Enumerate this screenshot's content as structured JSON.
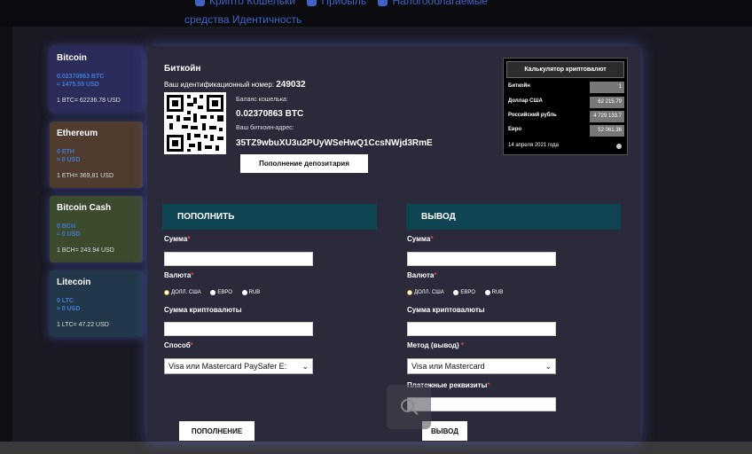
{
  "topnav": {
    "row1": [
      "Крипто Кошельки",
      "Прибыль",
      "Налогооблагаемые"
    ],
    "row2": [
      "средства",
      "Идентичность"
    ]
  },
  "wallets": [
    {
      "name": "Bitcoin",
      "amount": "0.02370863 BTC",
      "usd": "≈ 1475.55 USD",
      "rate": "1 BTC= 62236.78 USD",
      "color": "#2b2c5a"
    },
    {
      "name": "Ethereum",
      "amount": "0 ETH",
      "usd": "≈ 0 USD",
      "rate": "1 ETH= 369,81 USD",
      "color": "#4f3c2e"
    },
    {
      "name": "Bitcoin Cash",
      "amount": "0 BCH",
      "usd": "≈ 0 USD",
      "rate": "1 BCH= 243.94 USD",
      "color": "#3c4a2e"
    },
    {
      "name": "Litecoin",
      "amount": "0 LTC",
      "usd": "≈ 0 USD",
      "rate": "1 LTC= 47.22 USD",
      "color": "#22384a"
    }
  ],
  "header": {
    "title": "Биткойн",
    "id_label": "Ваш идентификационный номер:",
    "id_value": "249032",
    "balance_label": "Баланс кошелька:",
    "balance_value": "0.02370863 BTC",
    "address_label": "Ваш биткоин-адрес:",
    "address_value": "35TZ9wbuXU3u2PUyWSeHwQ1CcsNWjd3RmE",
    "deposit_button": "Пополнение депозитария"
  },
  "calculator": {
    "title": "Калькулятор криптовалют",
    "rows": [
      {
        "label": "Биткойн",
        "value": "1"
      },
      {
        "label": "Доллар США",
        "value": "62 215.79"
      },
      {
        "label": "Российский рубль",
        "value": "4 729 133.7"
      },
      {
        "label": "Евро",
        "value": "52 061.36"
      }
    ],
    "date": "14 апреля 2021 года"
  },
  "deposit": {
    "heading": "ПОПОЛНИТЬ",
    "amount_label": "Сумма",
    "currency_label": "Валюта",
    "currency_options": [
      "ДОЛЛ. США",
      "ЕВРО",
      "RUB"
    ],
    "crypto_amount_label": "Сумма криптовалюты",
    "method_label": "Способ",
    "method_value": "Visa или Mastercard PaySafer E:",
    "submit": "ПОПОЛНЕНИЕ"
  },
  "withdraw": {
    "heading": "ВЫВОД",
    "amount_label": "Сумма",
    "currency_label": "Валюта",
    "currency_options": [
      "ДОЛЛ. США",
      "ЕВРО",
      "RUB"
    ],
    "crypto_amount_label": "Сумма криптовалюты",
    "method_label": "Метод (вывод)",
    "method_value": "Visa или Mastercard",
    "details_label": "Платежные реквизиты",
    "submit": "ВЫВОД"
  },
  "required_mark": "*"
}
